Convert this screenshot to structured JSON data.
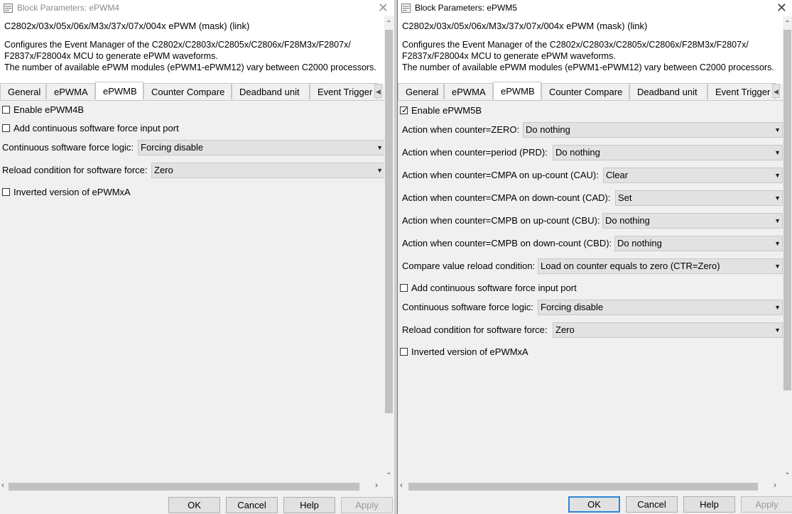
{
  "colors": {
    "accent": "#2f86d8",
    "background": "#f0f0f0",
    "control": "#e2e2e2"
  },
  "left": {
    "title": "Block Parameters: ePWM4",
    "mask_title": "C2802x/03x/05x/06x/M3x/37x/07x/004x ePWM (mask) (link)",
    "description": [
      "Configures the Event Manager of the C2802x/C2803x/C2805x/C2806x/F28M3x/F2807x/",
      "F2837x/F28004x MCU to generate ePWM waveforms.",
      "The number of available ePWM modules (ePWM1-ePWM12) vary between C2000 processors."
    ],
    "tabs": [
      "General",
      "ePWMA",
      "ePWMB",
      "Counter Compare",
      "Deadband unit",
      "Event Trigger"
    ],
    "active_tab": "ePWMB",
    "enable_checkbox": {
      "label": "Enable ePWM4B",
      "checked": false
    },
    "add_force_port": {
      "label": "Add continuous software force input port",
      "checked": false
    },
    "force_logic": {
      "label": "Continuous software force logic:",
      "value": "Forcing disable"
    },
    "reload_condition": {
      "label": "Reload condition for software force:",
      "value": "Zero"
    },
    "inverted": {
      "label": "Inverted version of ePWMxA",
      "checked": false
    },
    "buttons": {
      "ok": "OK",
      "cancel": "Cancel",
      "help": "Help",
      "apply": "Apply"
    }
  },
  "right": {
    "title": "Block Parameters: ePWM5",
    "mask_title": "C2802x/03x/05x/06x/M3x/37x/07x/004x ePWM (mask) (link)",
    "description": [
      "Configures the Event Manager of the C2802x/C2803x/C2805x/C2806x/F28M3x/F2807x/",
      "F2837x/F28004x MCU to generate ePWM waveforms.",
      "The number of available ePWM modules (ePWM1-ePWM12) vary between C2000 processors."
    ],
    "tabs": [
      "General",
      "ePWMA",
      "ePWMB",
      "Counter Compare",
      "Deadband unit",
      "Event Trigger"
    ],
    "active_tab": "ePWMB",
    "enable_checkbox": {
      "label": "Enable ePWM5B",
      "checked": true
    },
    "actions": [
      {
        "label": "Action when counter=ZERO:",
        "value": "Do nothing"
      },
      {
        "label": "Action when counter=period (PRD):",
        "value": "Do nothing"
      },
      {
        "label": "Action when counter=CMPA on up-count (CAU):",
        "value": "Clear"
      },
      {
        "label": "Action when counter=CMPA on down-count (CAD):",
        "value": "Set"
      },
      {
        "label": "Action when counter=CMPB on up-count (CBU):",
        "value": "Do nothing"
      },
      {
        "label": "Action when counter=CMPB on down-count (CBD):",
        "value": "Do nothing"
      },
      {
        "label": "Compare value reload condition:",
        "value": "Load on counter equals to zero (CTR=Zero)"
      }
    ],
    "add_force_port": {
      "label": "Add continuous software force input port",
      "checked": false
    },
    "force_logic": {
      "label": "Continuous software force logic:",
      "value": "Forcing disable"
    },
    "reload_condition": {
      "label": "Reload condition for software force:",
      "value": "Zero"
    },
    "inverted": {
      "label": "Inverted version of ePWMxA",
      "checked": false
    },
    "buttons": {
      "ok": "OK",
      "cancel": "Cancel",
      "help": "Help",
      "apply": "Apply"
    }
  }
}
